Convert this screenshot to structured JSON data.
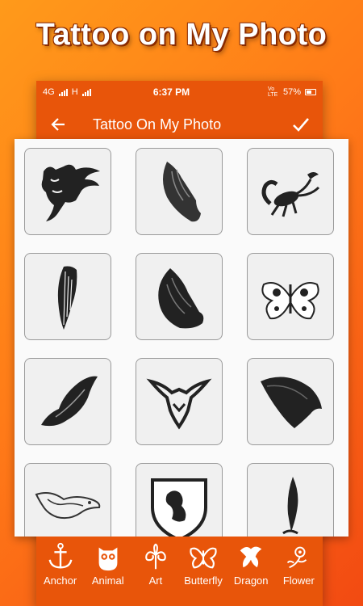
{
  "promo": {
    "title": "Tattoo on My Photo"
  },
  "status_bar": {
    "network": "4G",
    "network2": "H",
    "time": "6:37 PM",
    "volte": "Vo LTE",
    "battery": "57%"
  },
  "app_bar": {
    "title": "Tattoo On My Photo"
  },
  "tattoos": [
    {
      "icon": "bull-tattoo-icon"
    },
    {
      "icon": "wing-dragon-tattoo-icon"
    },
    {
      "icon": "scorpion-tattoo-icon"
    },
    {
      "icon": "feather-wing-tattoo-icon"
    },
    {
      "icon": "eagle-wing-tattoo-icon"
    },
    {
      "icon": "butterfly-tattoo-icon"
    },
    {
      "icon": "bird-wing-tattoo-icon"
    },
    {
      "icon": "tribal-dragon-tattoo-icon"
    },
    {
      "icon": "black-wing-tattoo-icon"
    },
    {
      "icon": "dove-tattoo-icon"
    },
    {
      "icon": "lion-shield-tattoo-icon"
    },
    {
      "icon": "horn-tattoo-icon"
    }
  ],
  "categories": [
    {
      "label": "Anchor",
      "icon": "anchor-icon"
    },
    {
      "label": "Animal",
      "icon": "owl-icon"
    },
    {
      "label": "Art",
      "icon": "swirl-art-icon"
    },
    {
      "label": "Butterfly",
      "icon": "butterfly-icon"
    },
    {
      "label": "Dragon",
      "icon": "dragon-icon"
    },
    {
      "label": "Flower",
      "icon": "flower-icon"
    }
  ],
  "colors": {
    "accent": "#e8550a",
    "background_gradient_start": "#ff9a1a",
    "background_gradient_end": "#f24a12"
  }
}
